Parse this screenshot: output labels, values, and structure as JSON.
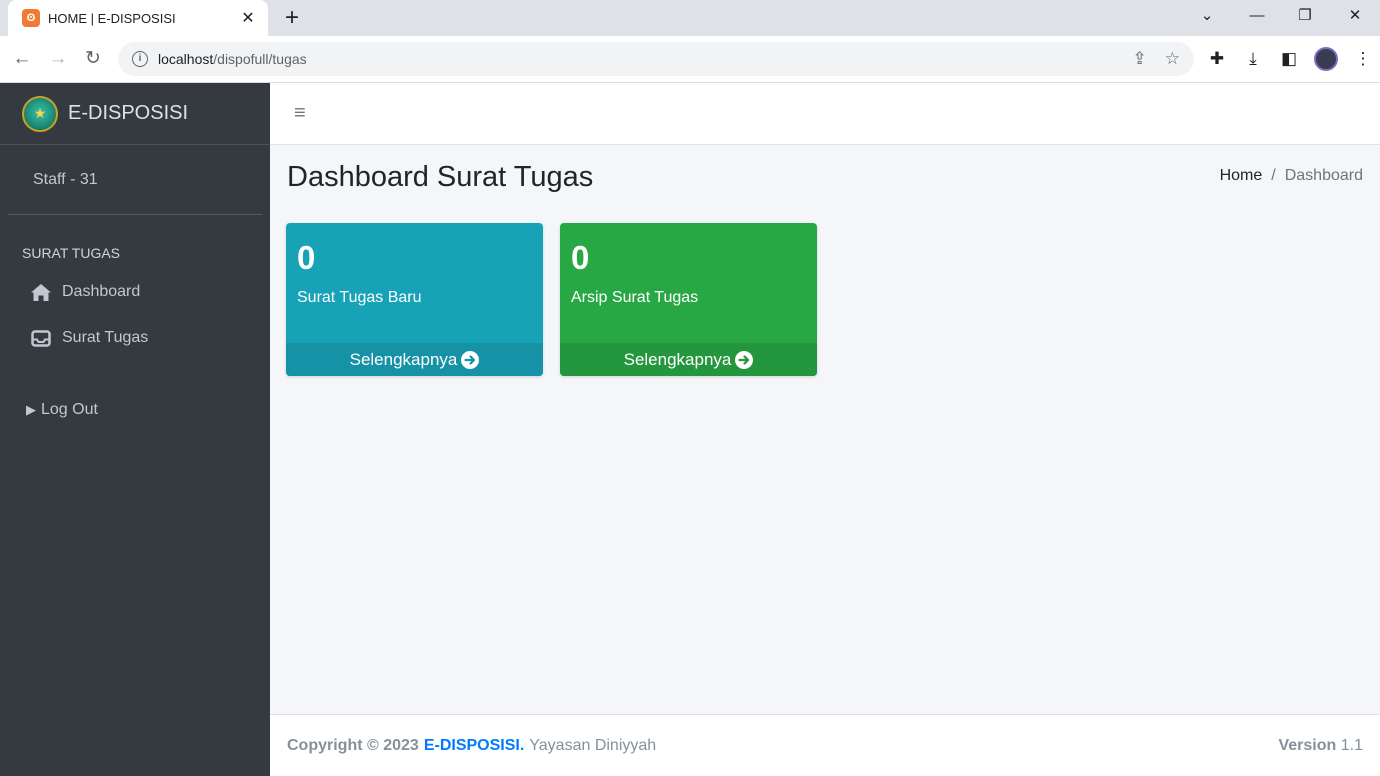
{
  "browser": {
    "tab_title": "HOME | E-DISPOSISI",
    "url_host": "localhost",
    "url_path": "/dispofull/tugas"
  },
  "sidebar": {
    "brand": "E-DISPOSISI",
    "user": "Staff - 31",
    "section_header": "SURAT TUGAS",
    "items": [
      {
        "label": "Dashboard",
        "icon": "home-icon"
      },
      {
        "label": "Surat Tugas",
        "icon": "inbox-icon"
      }
    ],
    "logout": "Log Out"
  },
  "content": {
    "title": "Dashboard Surat Tugas",
    "breadcrumb": {
      "home": "Home",
      "separator": "/",
      "active": "Dashboard"
    },
    "boxes": [
      {
        "count": "0",
        "label": "Surat Tugas Baru",
        "link": "Selengkapnya",
        "color": "#17a2b8"
      },
      {
        "count": "0",
        "label": "Arsip Surat Tugas",
        "link": "Selengkapnya",
        "color": "#28a745"
      }
    ]
  },
  "footer": {
    "copyright": "Copyright © 2023",
    "brand": "E-DISPOSISI.",
    "org": "Yayasan Diniyyah",
    "version_label": "Version",
    "version": "1.1"
  }
}
